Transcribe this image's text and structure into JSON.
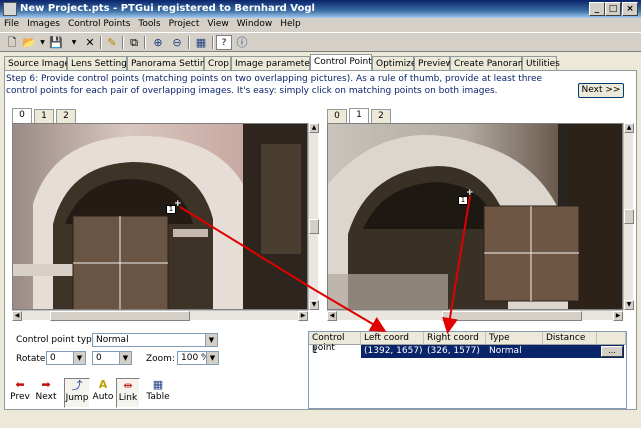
{
  "window": {
    "title": "New Project.pts - PTGui registered to Bernhard Vogl",
    "min": "_",
    "max": "□",
    "close": "×"
  },
  "menus": [
    "File",
    "Images",
    "Control Points",
    "Tools",
    "Project",
    "View",
    "Window",
    "Help"
  ],
  "tabs": [
    "Source Images",
    "Lens Settings",
    "Panorama Settings",
    "Crop",
    "Image parameters",
    "Control Points",
    "Optimizer",
    "Preview",
    "Create Panorama",
    "Utilities"
  ],
  "active_tab": "Control Points",
  "instructions": "Step 6: Provide control points (matching points on two overlapping pictures). As a rule of thumb, provide at least three control points for each pair of overlapping images. It's easy: simply click on matching points on both images.",
  "next_label": "Next >>",
  "left_image_tabs": [
    "0",
    "1",
    "2"
  ],
  "right_image_tabs": [
    "0",
    "1",
    "2"
  ],
  "cp_label": "1",
  "controls": {
    "cp_type_label": "Control point type:",
    "cp_type_value": "Normal",
    "rotate_label": "Rotate:",
    "rotate_left": "0",
    "rotate_right": "0",
    "zoom_label": "Zoom:",
    "zoom_value": "100 %"
  },
  "bottom_buttons": {
    "prev": "Prev",
    "next": "Next",
    "jump": "Jump",
    "auto": "Auto",
    "link": "Link",
    "table": "Table"
  },
  "table": {
    "headers": [
      "Control point",
      "Left coord",
      "Right coord",
      "Type",
      "Distance"
    ],
    "rows": [
      {
        "cp": "1",
        "left": "(1392, 1657)",
        "right": "(326, 1577)",
        "type": "Normal",
        "distance": "",
        "btn": "..."
      }
    ]
  }
}
